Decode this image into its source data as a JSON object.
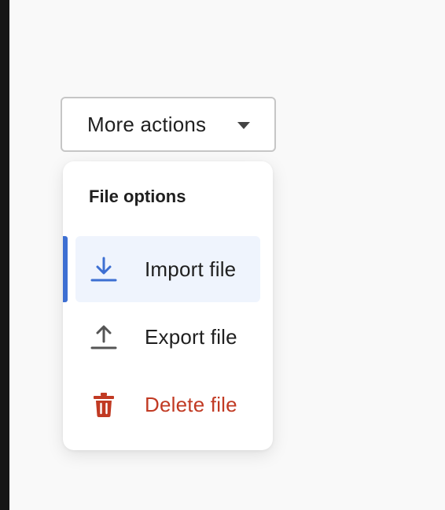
{
  "trigger": {
    "label": "More actions",
    "caret_icon": "caret-down-icon"
  },
  "menu": {
    "heading": "File options",
    "items": [
      {
        "label": "Import file",
        "icon": "download-icon",
        "color": "#1f1f1f",
        "icon_color": "#3d6fd2",
        "active": true
      },
      {
        "label": "Export file",
        "icon": "upload-icon",
        "color": "#1f1f1f",
        "icon_color": "#555555",
        "active": false
      },
      {
        "label": "Delete file",
        "icon": "trash-icon",
        "color": "#c13a23",
        "icon_color": "#c13a23",
        "active": false
      }
    ]
  },
  "colors": {
    "accent": "#3d6fd2",
    "active_bg": "#eff4fd",
    "danger": "#c13a23"
  }
}
